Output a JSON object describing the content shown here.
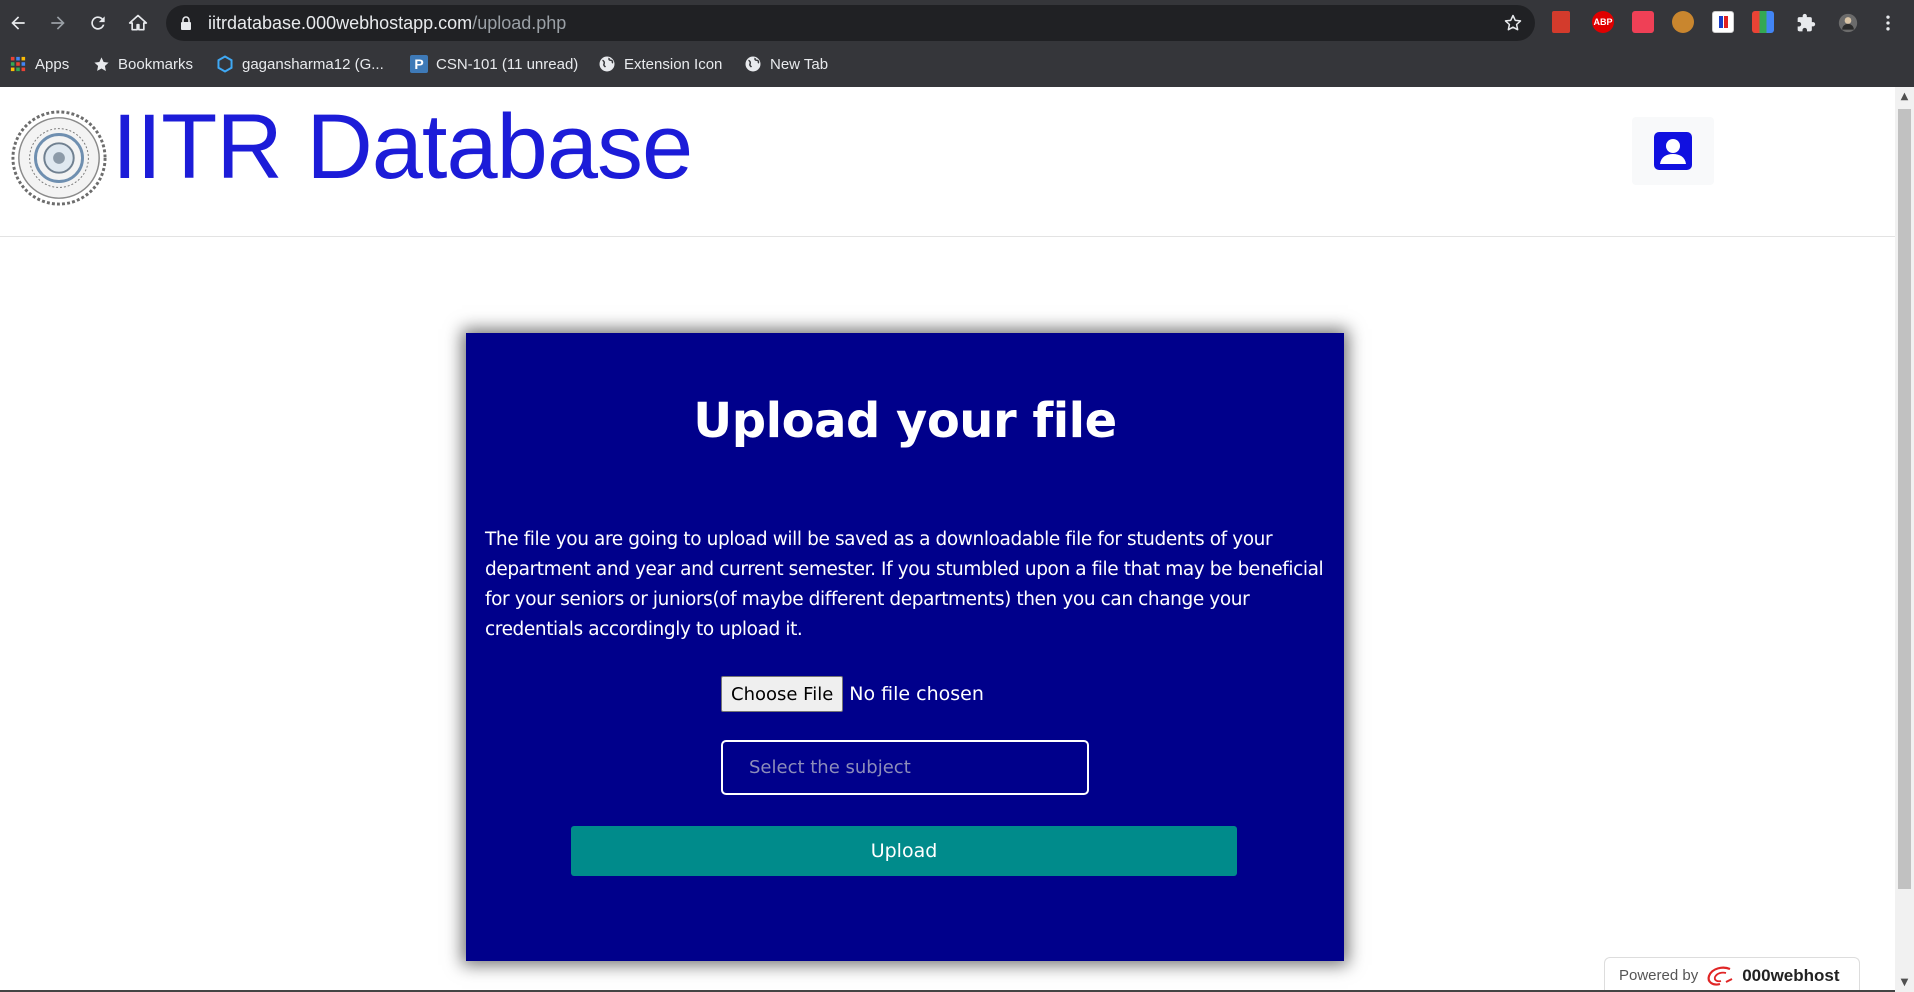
{
  "browser": {
    "url_host": "iitrdatabase.000webhostapp.com",
    "url_path": "/upload.php",
    "extensions": [
      {
        "name": "red-book-extension",
        "color": "#d33b2c",
        "label": ""
      },
      {
        "name": "adblock-plus-extension",
        "color": "#e00000",
        "label": "ABP"
      },
      {
        "name": "pocket-extension",
        "color": "#ef4056",
        "label": ""
      },
      {
        "name": "cookie-extension",
        "color": "#c9862e",
        "label": ""
      },
      {
        "name": "flag-extension",
        "color": "#ffffff",
        "label": ""
      },
      {
        "name": "color-grid-extension",
        "color": "#7fc43e",
        "label": ""
      }
    ]
  },
  "bookmarks": [
    {
      "label": "Apps",
      "icon": "apps-grid-icon"
    },
    {
      "label": "Bookmarks",
      "icon": "star-icon"
    },
    {
      "label": "gagansharma12 (G...",
      "icon": "hexagon-icon"
    },
    {
      "label": "CSN-101 (11 unread)",
      "icon": "piazza-icon"
    },
    {
      "label": "Extension Icon",
      "icon": "globe-icon"
    },
    {
      "label": "New Tab",
      "icon": "globe-icon"
    }
  ],
  "site": {
    "title": "IITR Database"
  },
  "upload": {
    "heading": "Upload your file",
    "description": "The file you are going to upload will be saved as a downloadable file for students of your department and year and current semester. If you stumbled upon a file that may be beneficial for your seniors or juniors(of maybe different departments) then you can change your credentials accordingly to upload it.",
    "choose_file_label": "Choose File",
    "file_status": "No file chosen",
    "subject_placeholder": "Select the subject",
    "submit_label": "Upload"
  },
  "footer": {
    "powered_by": "Powered by",
    "brand": "000webhost"
  },
  "colors": {
    "card_bg": "#00008b",
    "title_blue": "#1c1cd8",
    "upload_button": "#008b8b"
  }
}
